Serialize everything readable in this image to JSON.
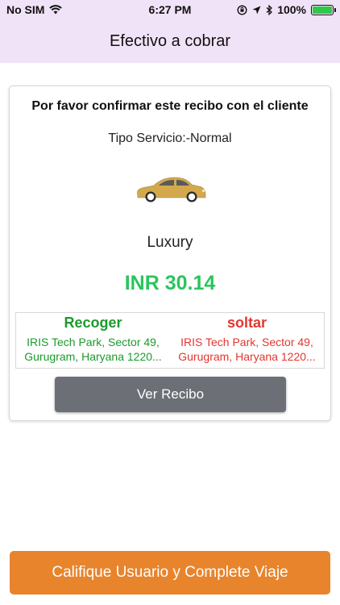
{
  "status_bar": {
    "carrier": "No SIM",
    "time": "6:27 PM",
    "battery_percent": "100%",
    "icons": [
      "wifi-icon",
      "orientation-lock-icon",
      "location-arrow-icon",
      "bluetooth-icon",
      "battery-icon"
    ]
  },
  "header": {
    "title": "Efectivo a cobrar"
  },
  "receipt": {
    "confirm_text": "Por favor confirmar este recibo con el cliente",
    "service_type": "Tipo Servicio:-Normal",
    "car_icon": "sedan-car-icon",
    "car_type": "Luxury",
    "fare": "INR 30.14",
    "pickup": {
      "label": "Recoger",
      "line1": "IRIS Tech Park, Sector 49,",
      "line2": "Gurugram, Haryana 1220..."
    },
    "drop": {
      "label": "soltar",
      "line1": "IRIS Tech Park, Sector 49,",
      "line2": "Gurugram, Haryana 1220..."
    },
    "view_receipt_label": "Ver Recibo"
  },
  "footer": {
    "complete_label": "Califique Usuario y Complete Viaje"
  },
  "colors": {
    "header_bg": "#f1e3f7",
    "fare": "#2bc45e",
    "pickup": "#1c9a2c",
    "drop": "#e2362f",
    "receipt_button": "#6c6f75",
    "complete_button": "#e8842c",
    "car": "#d4a94e"
  }
}
